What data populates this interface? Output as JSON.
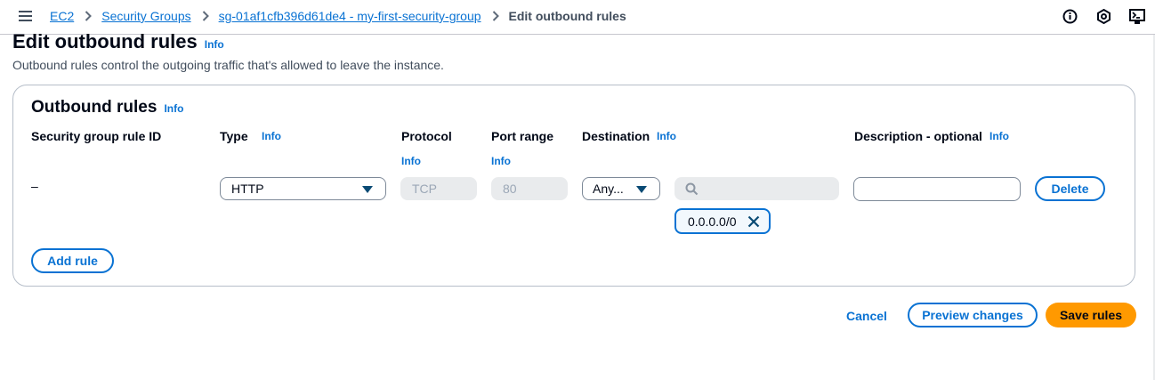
{
  "breadcrumb": {
    "items": [
      "EC2",
      "Security Groups",
      "sg-01af1cfb396d61de4 - my-first-security-group"
    ],
    "current": "Edit outbound rules"
  },
  "header": {
    "title": "Edit outbound rules",
    "title_info": "Info",
    "description": "Outbound rules control the outgoing traffic that's allowed to leave the instance."
  },
  "panel": {
    "title": "Outbound rules",
    "title_info": "Info",
    "columns": {
      "rule_id": "Security group rule ID",
      "type": "Type",
      "type_info": "Info",
      "protocol": "Protocol",
      "protocol_info": "Info",
      "port_range": "Port range",
      "port_range_info": "Info",
      "destination": "Destination",
      "destination_info": "Info",
      "description": "Description - optional",
      "description_info": "Info"
    },
    "rule": {
      "rule_id": "–",
      "type": "HTTP",
      "protocol": "TCP",
      "port_range": "80",
      "destination_mode": "Any...",
      "destination_search": "",
      "destination_token": "0.0.0.0/0",
      "description": "",
      "delete_label": "Delete"
    },
    "add_rule_label": "Add rule"
  },
  "footer": {
    "cancel_label": "Cancel",
    "preview_label": "Preview changes",
    "save_label": "Save rules"
  },
  "icons": {
    "menu": "hamburger-menu-icon",
    "info": "info-circle-icon",
    "notifications": "notification-icon",
    "console": "cloudshell-icon"
  },
  "colors": {
    "link": "#0972d3",
    "primary_button": "#ff9900",
    "text": "#000716",
    "border": "#b6bec9"
  }
}
